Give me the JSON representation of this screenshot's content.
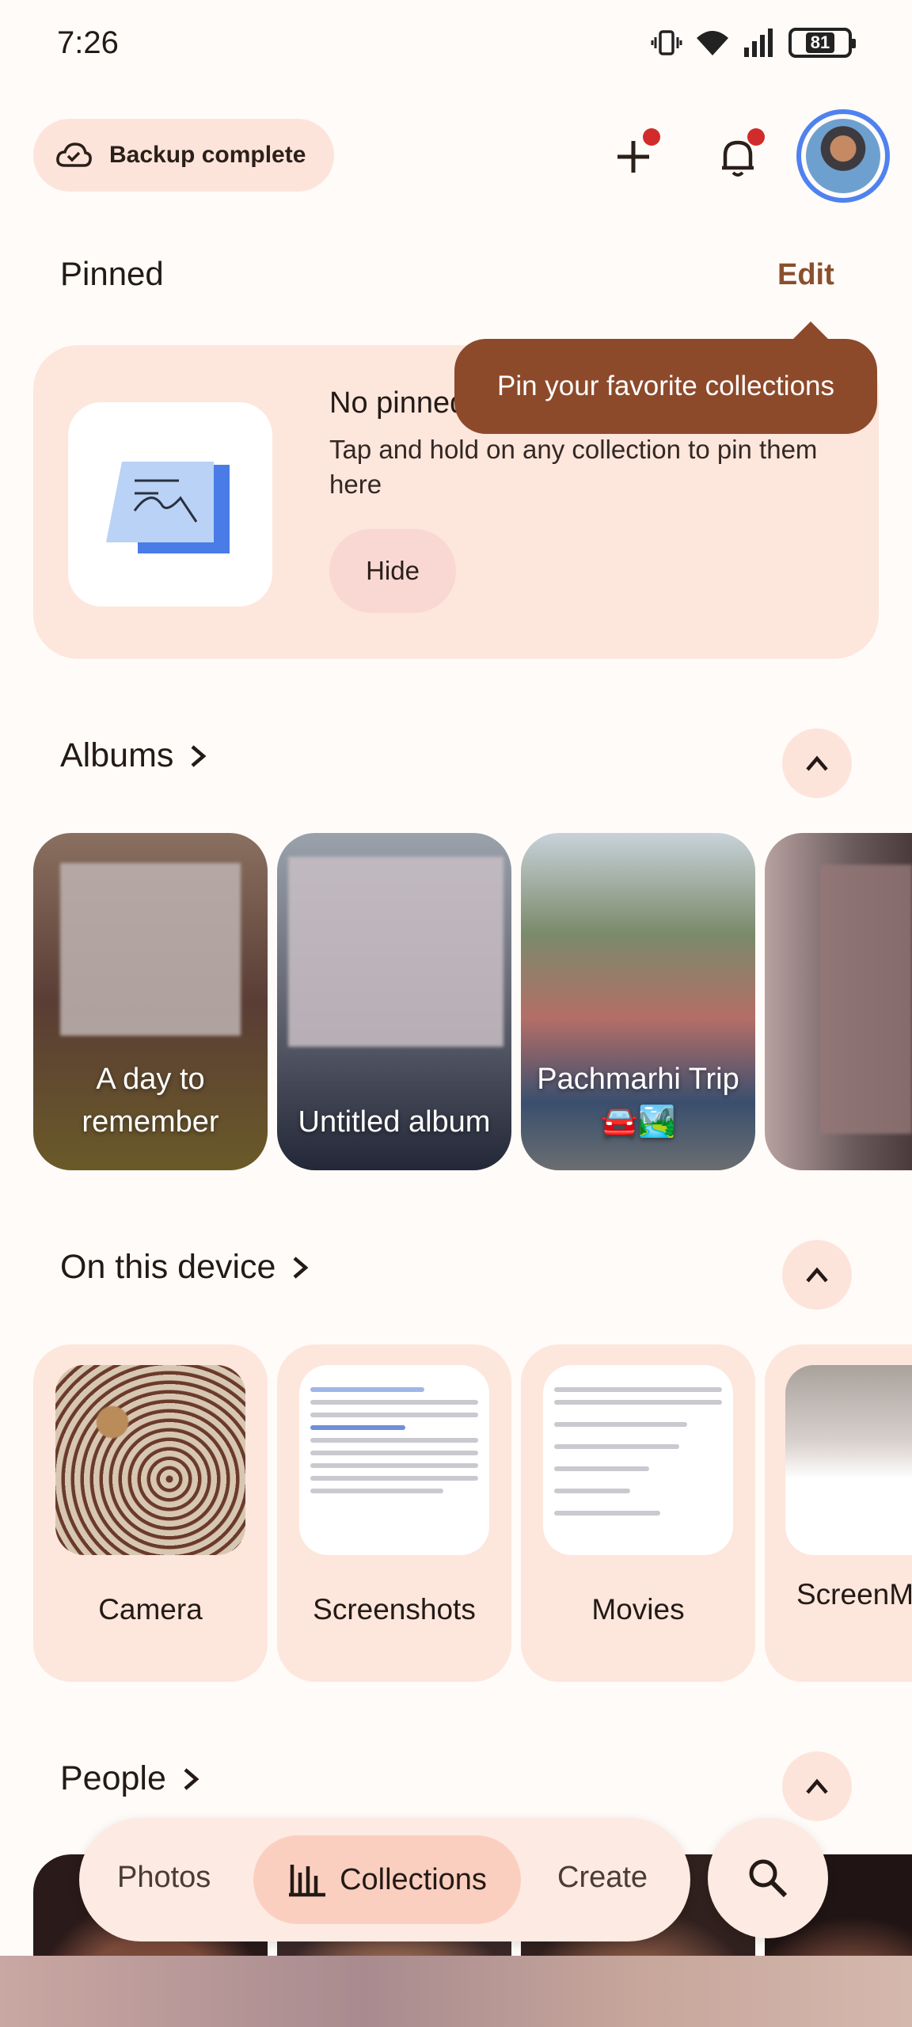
{
  "status": {
    "time": "7:26",
    "battery": "81"
  },
  "header": {
    "backup_label": "Backup complete"
  },
  "pinned": {
    "title": "Pinned",
    "edit_label": "Edit",
    "empty_title": "No pinned",
    "empty_desc": "Tap and hold on any collection to pin them here",
    "hide_label": "Hide",
    "tooltip": "Pin your favorite collections"
  },
  "albums": {
    "title": "Albums",
    "items": [
      {
        "label": "A day to remember"
      },
      {
        "label": "Untitled album"
      },
      {
        "label": "Pachmarhi Trip 🚘🏞️"
      }
    ]
  },
  "device": {
    "title": "On this device",
    "folders": [
      {
        "label": "Camera"
      },
      {
        "label": "Screenshots"
      },
      {
        "label": "Movies"
      },
      {
        "label": "ScreenMaster"
      }
    ]
  },
  "people": {
    "title": "People"
  },
  "nav": {
    "photos": "Photos",
    "collections": "Collections",
    "create": "Create"
  },
  "colors": {
    "accent": "#8c4a2b",
    "chip": "#fde4da",
    "card": "#fde6dc",
    "active_tab": "#fbcfbf"
  }
}
